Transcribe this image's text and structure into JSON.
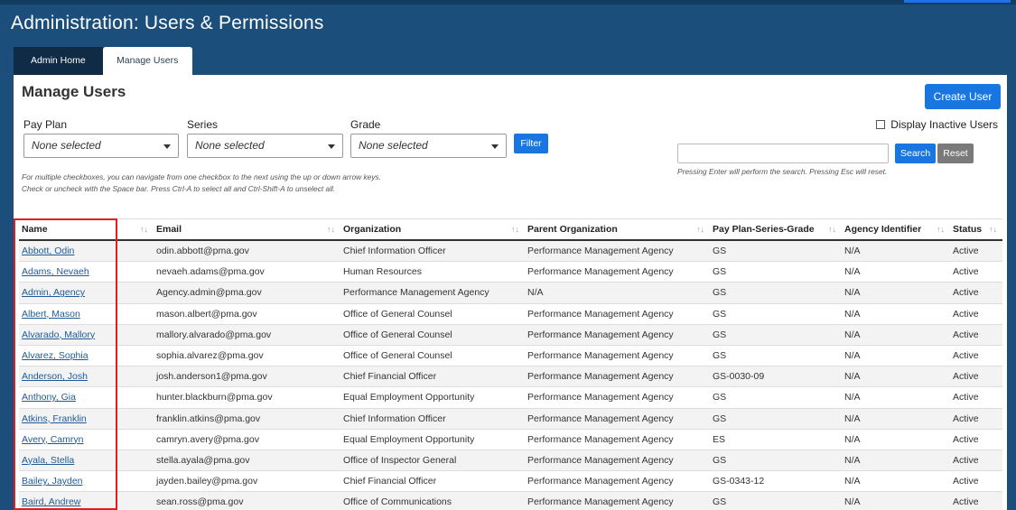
{
  "header": {
    "title": "Administration: Users & Permissions"
  },
  "tabs": [
    {
      "label": "Admin Home"
    },
    {
      "label": "Manage Users"
    }
  ],
  "page": {
    "title": "Manage Users",
    "create_label": "Create User"
  },
  "filters": [
    {
      "label": "Pay Plan",
      "value": "None selected"
    },
    {
      "label": "Series",
      "value": "None selected"
    },
    {
      "label": "Grade",
      "value": "None selected"
    }
  ],
  "filter_button": "Filter",
  "help_text": [
    "For multiple checkboxes, you can navigate from one checkbox to the next using the up or down arrow keys.",
    "Check or uncheck with the Space bar. Press Ctrl-A to select all and Ctrl-Shift-A to unselect all."
  ],
  "search": {
    "inactive_label": "Display Inactive Users",
    "value": "",
    "button_label": "Search",
    "reset_label": "Reset",
    "note": "Pressing Enter will perform the search. Pressing Esc will reset."
  },
  "table": {
    "columns": [
      "Name",
      "Email",
      "Organization",
      "Parent Organization",
      "Pay Plan-Series-Grade",
      "Agency Identifier",
      "Status"
    ],
    "rows": [
      [
        "Abbott, Odin",
        "odin.abbott@pma.gov",
        "Chief Information Officer",
        "Performance Management Agency",
        "GS",
        "N/A",
        "Active"
      ],
      [
        "Adams, Nevaeh",
        "nevaeh.adams@pma.gov",
        "Human Resources",
        "Performance Management Agency",
        "GS",
        "N/A",
        "Active"
      ],
      [
        "Admin, Agency",
        "Agency.admin@pma.gov",
        "Performance Management Agency",
        "N/A",
        "GS",
        "N/A",
        "Active"
      ],
      [
        "Albert, Mason",
        "mason.albert@pma.gov",
        "Office of General Counsel",
        "Performance Management Agency",
        "GS",
        "N/A",
        "Active"
      ],
      [
        "Alvarado, Mallory",
        "mallory.alvarado@pma.gov",
        "Office of General Counsel",
        "Performance Management Agency",
        "GS",
        "N/A",
        "Active"
      ],
      [
        "Alvarez, Sophia",
        "sophia.alvarez@pma.gov",
        "Office of General Counsel",
        "Performance Management Agency",
        "GS",
        "N/A",
        "Active"
      ],
      [
        "Anderson, Josh",
        "josh.anderson1@pma.gov",
        "Chief Financial Officer",
        "Performance Management Agency",
        "GS-0030-09",
        "N/A",
        "Active"
      ],
      [
        "Anthony, Gia",
        "hunter.blackburn@pma.gov",
        "Equal Employment Opportunity",
        "Performance Management Agency",
        "GS",
        "N/A",
        "Active"
      ],
      [
        "Atkins, Franklin",
        "franklin.atkins@pma.gov",
        "Chief Information Officer",
        "Performance Management Agency",
        "GS",
        "N/A",
        "Active"
      ],
      [
        "Avery, Camryn",
        "camryn.avery@pma.gov",
        "Equal Employment Opportunity",
        "Performance Management Agency",
        "ES",
        "N/A",
        "Active"
      ],
      [
        "Ayala, Stella",
        "stella.ayala@pma.gov",
        "Office of Inspector General",
        "Performance Management Agency",
        "GS",
        "N/A",
        "Active"
      ],
      [
        "Bailey, Jayden",
        "jayden.bailey@pma.gov",
        "Chief Financial Officer",
        "Performance Management Agency",
        "GS-0343-12",
        "N/A",
        "Active"
      ],
      [
        "Baird, Andrew",
        "sean.ross@pma.gov",
        "Office of Communications",
        "Performance Management Agency",
        "GS",
        "N/A",
        "Active"
      ]
    ]
  }
}
